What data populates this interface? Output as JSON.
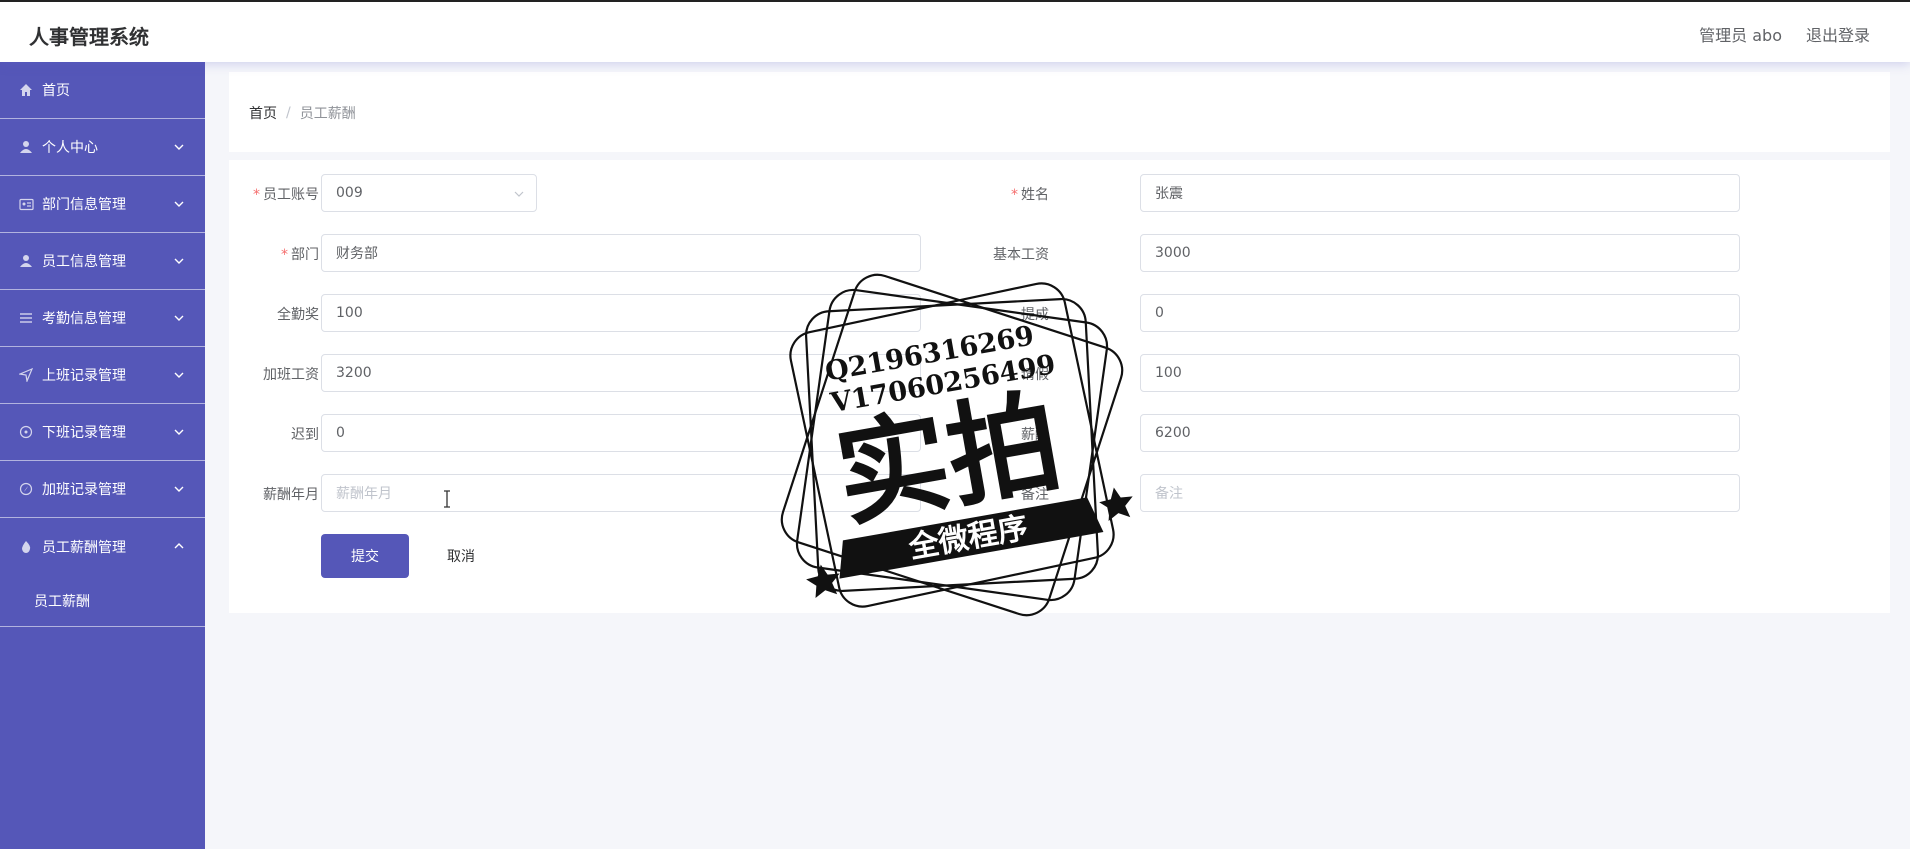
{
  "header": {
    "app_title": "人事管理系统",
    "user_label": "管理员 abo",
    "logout_label": "退出登录"
  },
  "sidebar": {
    "items": [
      {
        "label": "首页",
        "icon": "home-icon"
      },
      {
        "label": "个人中心",
        "icon": "user-icon"
      },
      {
        "label": "部门信息管理",
        "icon": "id-card-icon"
      },
      {
        "label": "员工信息管理",
        "icon": "user-icon"
      },
      {
        "label": "考勤信息管理",
        "icon": "list-icon"
      },
      {
        "label": "上班记录管理",
        "icon": "send-icon"
      },
      {
        "label": "下班记录管理",
        "icon": "target-icon"
      },
      {
        "label": "加班记录管理",
        "icon": "compass-icon"
      },
      {
        "label": "员工薪酬管理",
        "icon": "flame-icon"
      }
    ],
    "submenu": [
      {
        "label": "员工薪酬"
      }
    ]
  },
  "breadcrumb": {
    "home": "首页",
    "separator": "/",
    "current": "员工薪酬"
  },
  "form": {
    "employee_id": {
      "label": "员工账号",
      "value": "009",
      "required": true
    },
    "name": {
      "label": "姓名",
      "value": "张震",
      "required": true
    },
    "department": {
      "label": "部门",
      "value": "财务部",
      "required": true
    },
    "base_salary": {
      "label": "基本工资",
      "value": "3000"
    },
    "attendance_bonus": {
      "label": "全勤奖",
      "value": "100"
    },
    "commission": {
      "label": "提成",
      "value": "0"
    },
    "overtime_pay": {
      "label": "加班工资",
      "value": "3200"
    },
    "leave": {
      "label": "请假",
      "value": "100"
    },
    "late": {
      "label": "迟到",
      "value": "0"
    },
    "salary": {
      "label": "薪酬",
      "value": "6200"
    },
    "salary_month": {
      "label": "薪酬年月",
      "placeholder": "薪酬年月"
    },
    "remark": {
      "label": "备注",
      "placeholder": "备注"
    },
    "submit_label": "提交",
    "cancel_label": "取消"
  },
  "watermark": {
    "line1": "Q2196316269",
    "line2": "V17060256499",
    "main": "实拍",
    "banner": "全微程序"
  }
}
